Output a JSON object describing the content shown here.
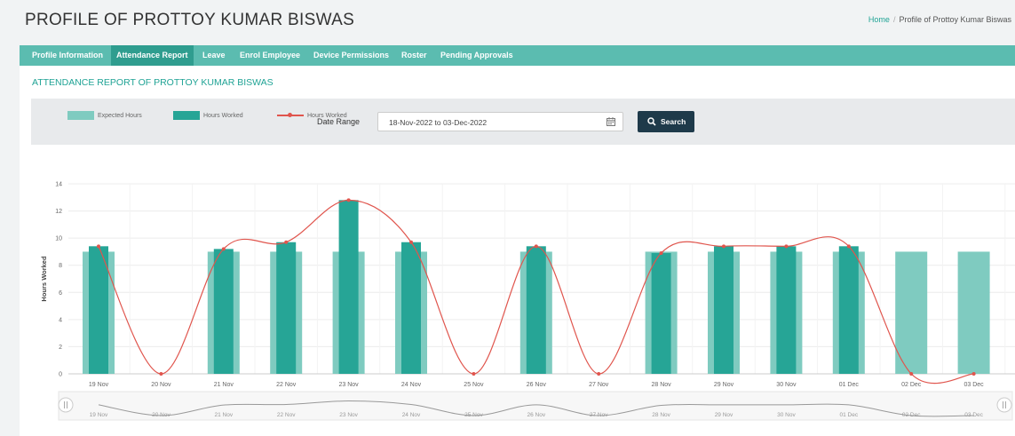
{
  "header": {
    "title": "PROFILE OF PROTTOY KUMAR BISWAS",
    "breadcrumb": {
      "home": "Home",
      "sep": "/",
      "current": "Profile of Prottoy Kumar Biswas"
    }
  },
  "tabs": [
    {
      "label": "Profile Information",
      "active": false
    },
    {
      "label": "Attendance Report",
      "active": true
    },
    {
      "label": "Leave",
      "active": false
    },
    {
      "label": "Enrol Employee",
      "active": false
    },
    {
      "label": "Device Permissions",
      "active": false
    },
    {
      "label": "Roster",
      "active": false
    },
    {
      "label": "Pending Approvals",
      "active": false
    }
  ],
  "section_title": "ATTENDANCE REPORT OF PROTTOY KUMAR BISWAS",
  "filter": {
    "date_label": "Date Range",
    "date_value": "18-Nov-2022 to 03-Dec-2022",
    "search_label": "Search"
  },
  "legend": {
    "expected": "Expected Hours",
    "worked_bar": "Hours Worked",
    "worked_line": "Hours Worked"
  },
  "colors": {
    "expected": "#7fcbc0",
    "worked": "#26a596",
    "line": "#e0554d",
    "tab_bar": "#5bbcb0",
    "tab_active": "#2f9d8f",
    "accent": "#20a395",
    "button": "#1e3a4a"
  },
  "chart_data": {
    "type": "bar",
    "categories": [
      "19 Nov",
      "20 Nov",
      "21 Nov",
      "22 Nov",
      "23 Nov",
      "24 Nov",
      "25 Nov",
      "26 Nov",
      "27 Nov",
      "28 Nov",
      "29 Nov",
      "30 Nov",
      "01 Dec",
      "02 Dec",
      "03 Dec"
    ],
    "series": [
      {
        "name": "Expected Hours",
        "type": "bar",
        "values": [
          9,
          0,
          9,
          9,
          9,
          9,
          0,
          9,
          0,
          9,
          9,
          9,
          9,
          9,
          9
        ]
      },
      {
        "name": "Hours Worked",
        "type": "bar",
        "values": [
          9.4,
          0,
          9.2,
          9.7,
          12.8,
          9.7,
          0,
          9.4,
          0,
          8.9,
          9.4,
          9.4,
          9.4,
          0,
          0
        ]
      },
      {
        "name": "Hours Worked",
        "type": "line",
        "values": [
          9.4,
          0,
          9.2,
          9.7,
          12.8,
          9.7,
          0,
          9.4,
          0,
          8.9,
          9.4,
          9.4,
          9.4,
          0,
          0
        ]
      }
    ],
    "ylabel": "Hours Worked",
    "ylim": [
      0,
      14
    ],
    "yticks": [
      0,
      2,
      4,
      6,
      8,
      10,
      12,
      14
    ],
    "grid": true,
    "legend": "top-left",
    "navigator": true
  }
}
